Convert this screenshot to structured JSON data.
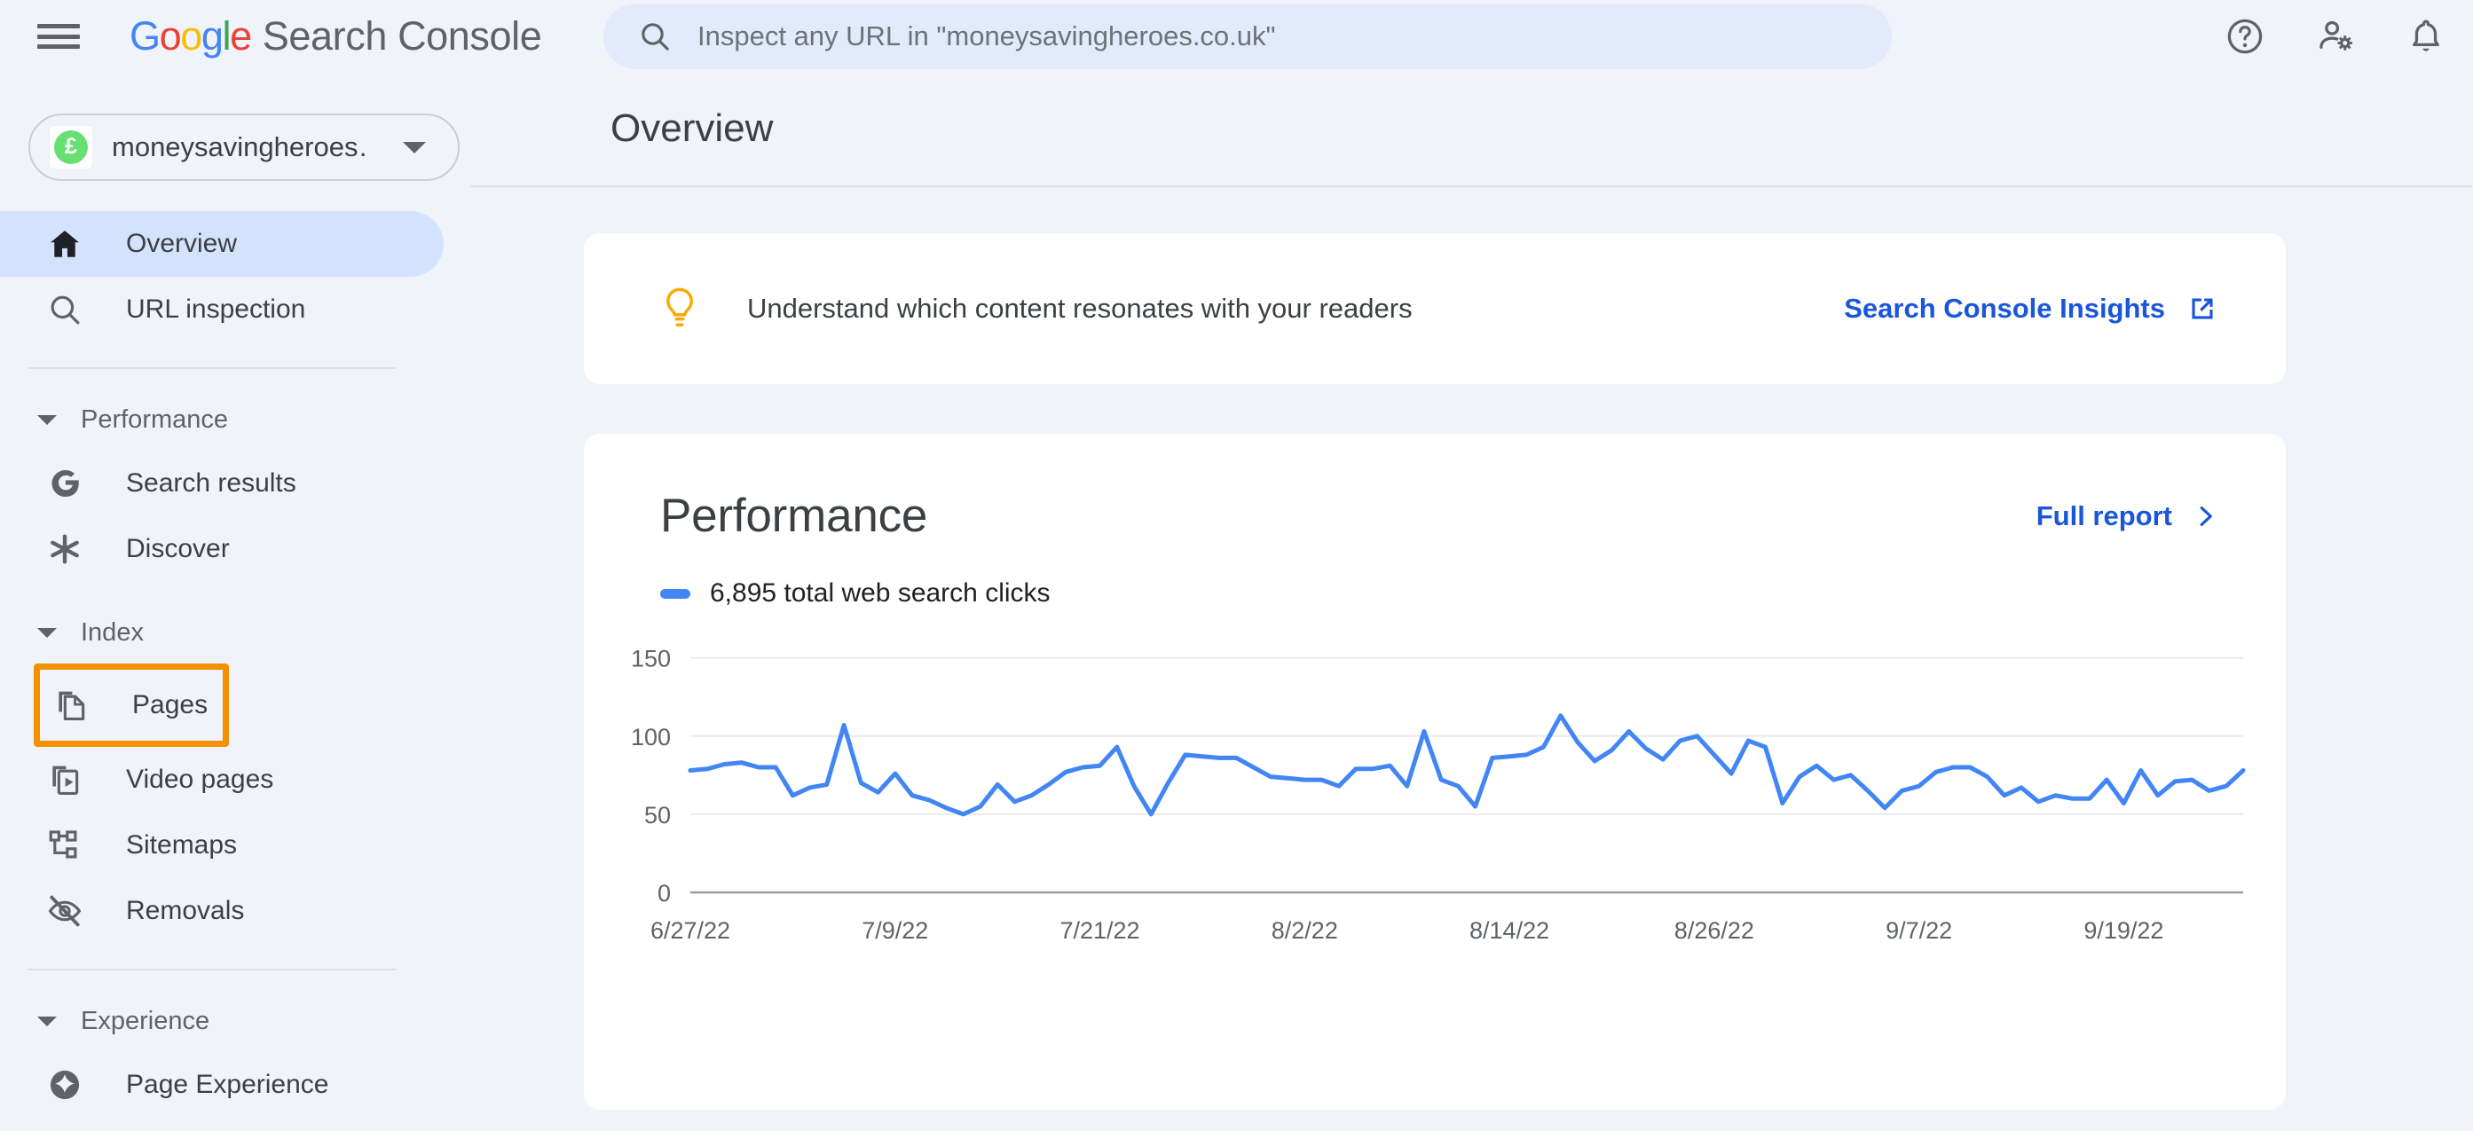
{
  "header": {
    "menu_icon": "hamburger-menu-icon",
    "brand_google": "Google",
    "brand_product": "Search Console",
    "search_placeholder": "Inspect any URL in \"moneysavingheroes.co.uk\"",
    "search_icon": "search-icon",
    "help_icon": "help-circle-icon",
    "account_settings_icon": "person-gear-icon",
    "notifications_icon": "bell-icon"
  },
  "sidebar": {
    "property": {
      "name": "moneysavingheroes…",
      "favicon_icon": "pound-coin-favicon",
      "favicon_glyph": "£",
      "dropdown_icon": "chevron-down-icon"
    },
    "items": [
      {
        "label": "Overview",
        "icon": "home-icon",
        "active": true
      },
      {
        "label": "URL inspection",
        "icon": "search-icon",
        "active": false
      }
    ],
    "groups": [
      {
        "label": "Performance",
        "caret_icon": "caret-down-icon",
        "items": [
          {
            "label": "Search results",
            "icon": "google-g-icon"
          },
          {
            "label": "Discover",
            "icon": "asterisk-icon"
          }
        ]
      },
      {
        "label": "Index",
        "caret_icon": "caret-down-icon",
        "items": [
          {
            "label": "Pages",
            "icon": "copy-pages-icon",
            "highlighted": true
          },
          {
            "label": "Video pages",
            "icon": "video-pages-icon"
          },
          {
            "label": "Sitemaps",
            "icon": "sitemap-icon"
          },
          {
            "label": "Removals",
            "icon": "eye-off-icon"
          }
        ]
      },
      {
        "label": "Experience",
        "caret_icon": "caret-down-icon",
        "items": [
          {
            "label": "Page Experience",
            "icon": "sparkle-circle-icon"
          }
        ]
      }
    ],
    "highlight_color": "#f59000",
    "active_color": "#d3e3fd"
  },
  "main": {
    "page_title": "Overview",
    "insights": {
      "icon": "lightbulb-icon",
      "icon_color": "#f9ab00",
      "message": "Understand which content resonates with your readers",
      "link_label": "Search Console Insights",
      "link_icon": "external-link-icon",
      "link_color": "#1a56db"
    },
    "performance": {
      "title": "Performance",
      "full_report_label": "Full report",
      "full_report_icon": "chevron-right-icon",
      "legend_label": "6,895 total web search clicks",
      "legend_color": "#4285f4"
    }
  },
  "chart_data": {
    "type": "line",
    "title": "Performance",
    "xlabel": "",
    "ylabel": "",
    "ylim": [
      0,
      160
    ],
    "yticks": [
      0,
      50,
      100,
      150
    ],
    "ytick_labels": [
      "0",
      "50",
      "100",
      "150"
    ],
    "grid": true,
    "legend_position": "top-left",
    "series": [
      {
        "name": "6,895 total web search clicks",
        "color": "#4285f4",
        "total": 6895,
        "values": [
          78,
          79,
          82,
          83,
          80,
          80,
          62,
          67,
          69,
          107,
          70,
          64,
          76,
          62,
          59,
          54,
          50,
          55,
          69,
          58,
          62,
          69,
          77,
          80,
          81,
          93,
          68,
          50,
          70,
          88,
          87,
          86,
          86,
          80,
          74,
          73,
          72,
          72,
          68,
          79,
          79,
          81,
          68,
          103,
          72,
          68,
          55,
          86,
          87,
          88,
          93,
          113,
          96,
          84,
          91,
          103,
          92,
          85,
          97,
          100,
          88,
          76,
          97,
          93,
          57,
          74,
          81,
          72,
          75,
          65,
          54,
          65,
          68,
          77,
          80,
          80,
          74,
          62,
          67,
          58,
          62,
          60,
          60,
          72,
          57,
          78,
          62,
          71,
          72,
          65,
          68,
          78
        ]
      }
    ],
    "xtick_labels": [
      "6/27/22",
      "7/9/22",
      "7/21/22",
      "8/2/22",
      "8/14/22",
      "8/26/22",
      "9/7/22",
      "9/19/22"
    ],
    "xtick_indices": [
      0,
      12,
      24,
      36,
      48,
      60,
      72,
      84
    ],
    "x_start": "6/27/22",
    "x_end": "9/19/22"
  }
}
